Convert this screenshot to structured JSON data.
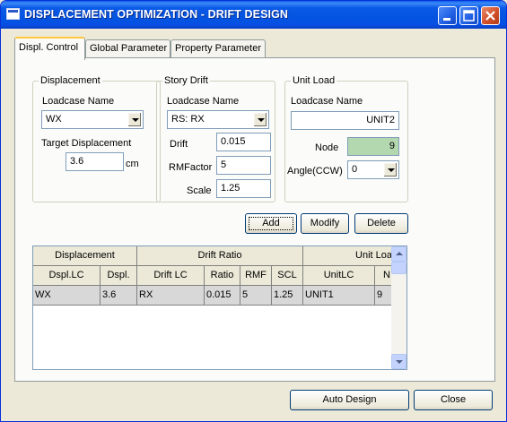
{
  "window": {
    "title": "DISPLACEMENT OPTIMIZATION - DRIFT DESIGN"
  },
  "tabs": [
    {
      "label": "Displ. Control"
    },
    {
      "label": "Global Parameter"
    },
    {
      "label": "Property Parameter"
    }
  ],
  "displacement": {
    "group_title": "Displacement",
    "loadcase_label": "Loadcase Name",
    "loadcase_value": "WX",
    "target_label": "Target Displacement",
    "target_value": "3.6",
    "unit": "cm"
  },
  "story_drift": {
    "group_title": "Story Drift",
    "loadcase_label": "Loadcase Name",
    "loadcase_value": "RS: RX",
    "drift_label": "Drift",
    "drift_value": "0.015",
    "rmfactor_label": "RMFactor",
    "rmfactor_value": "5",
    "scale_label": "Scale",
    "scale_value": "1.25"
  },
  "unit_load": {
    "group_title": "Unit Load",
    "loadcase_label": "Loadcase Name",
    "loadcase_value": "UNIT2",
    "node_label": "Node",
    "node_value": "9",
    "angle_label": "Angle(CCW)",
    "angle_value": "0"
  },
  "actions": {
    "add": "Add",
    "modify": "Modify",
    "delete": "Delete"
  },
  "grid": {
    "group_headers": [
      "Displacement",
      "Drift Ratio",
      "Unit Loa"
    ],
    "columns": [
      "Dspl.LC",
      "Dspl.",
      "Drift LC",
      "Ratio",
      "RMF",
      "SCL",
      "UnitLC",
      "N"
    ],
    "rows": [
      [
        "WX",
        "3.6",
        "RX",
        "0.015",
        "5",
        "1.25",
        "UNIT1",
        "9"
      ]
    ]
  },
  "footer": {
    "auto_design": "Auto Design",
    "close": "Close"
  },
  "colors": {
    "titlebar": "#0354e0",
    "readonly_field": "#b3d8b0",
    "dialog_bg": "#ece9d8"
  }
}
